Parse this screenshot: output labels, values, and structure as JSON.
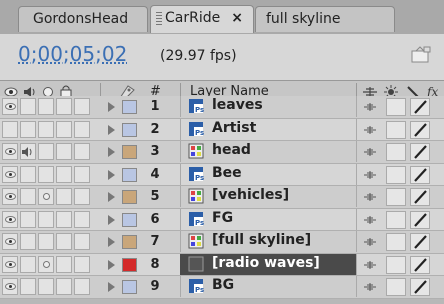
{
  "tabs": [
    {
      "label": "GordonsHead",
      "active": false
    },
    {
      "label": "CarRide",
      "active": true,
      "close": "×"
    },
    {
      "label": "full skyline",
      "active": false
    }
  ],
  "header": {
    "timecode": "0;00;05;02",
    "fps": "(29.97 fps)"
  },
  "columns": {
    "number": "#",
    "layer_name": "Layer Name"
  },
  "colors": {
    "timecode": "#3b6fb4",
    "selected_row": "#4a4a4a",
    "swatch_blue": "#b9c6e3",
    "swatch_tan": "#c9a67a",
    "swatch_red": "#d42a2a"
  },
  "layers": [
    {
      "num": "1",
      "name": "leaves",
      "icon": "photoshop-icon",
      "swatch": "#b9c6e3",
      "eye": true,
      "audio": false,
      "solo": false
    },
    {
      "num": "2",
      "name": "Artist",
      "icon": "photoshop-icon",
      "swatch": "#b9c6e3",
      "eye": false,
      "audio": false,
      "solo": false
    },
    {
      "num": "3",
      "name": "head",
      "icon": "composition-icon",
      "swatch": "#c9a67a",
      "eye": true,
      "audio": true,
      "solo": false
    },
    {
      "num": "4",
      "name": "Bee",
      "icon": "photoshop-icon",
      "swatch": "#b9c6e3",
      "eye": true,
      "audio": false,
      "solo": false
    },
    {
      "num": "5",
      "name": "[vehicles]",
      "icon": "composition-icon",
      "swatch": "#c9a67a",
      "eye": true,
      "audio": false,
      "solo": true
    },
    {
      "num": "6",
      "name": "FG",
      "icon": "photoshop-icon",
      "swatch": "#b9c6e3",
      "eye": true,
      "audio": false,
      "solo": false
    },
    {
      "num": "7",
      "name": "[full skyline]",
      "icon": "composition-icon",
      "swatch": "#c9a67a",
      "eye": true,
      "audio": false,
      "solo": false
    },
    {
      "num": "8",
      "name": "[radio waves]",
      "icon": "solid-icon",
      "swatch": "#d42a2a",
      "eye": true,
      "audio": false,
      "solo": true,
      "selected": true
    },
    {
      "num": "9",
      "name": "BG",
      "icon": "photoshop-icon",
      "swatch": "#b9c6e3",
      "eye": true,
      "audio": false,
      "solo": false
    }
  ]
}
